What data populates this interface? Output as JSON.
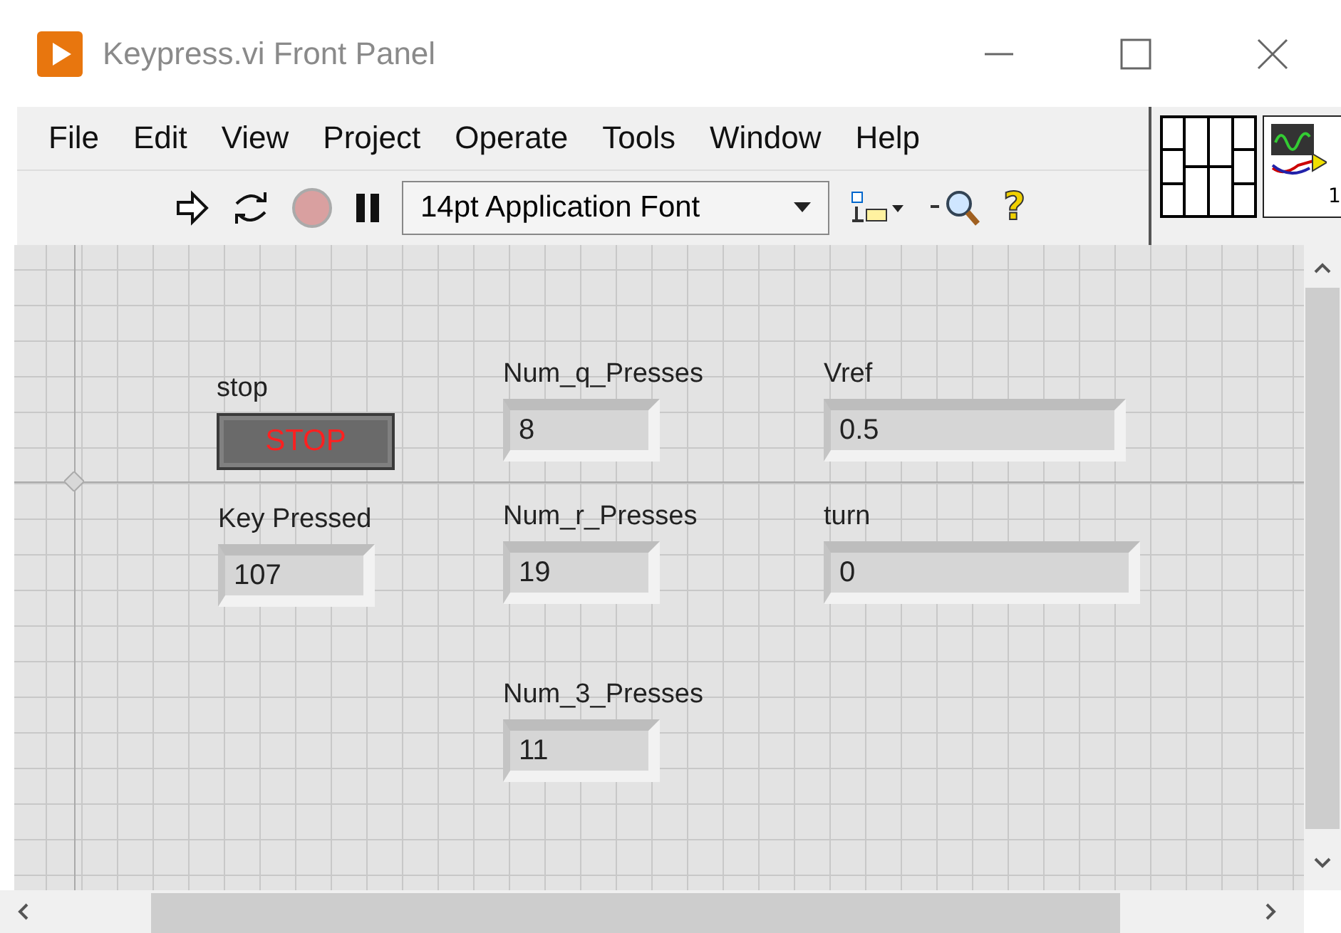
{
  "window": {
    "title": "Keypress.vi Front Panel"
  },
  "menu": [
    "File",
    "Edit",
    "View",
    "Project",
    "Operate",
    "Tools",
    "Window",
    "Help"
  ],
  "toolbar": {
    "font_selector": "14pt Application Font",
    "help_glyph": "?"
  },
  "vi_icon": {
    "label": "1"
  },
  "controls": [
    {
      "kind": "button",
      "label": "stop",
      "text": "STOP"
    },
    {
      "kind": "numeric",
      "label": "Key Pressed",
      "value": "107"
    },
    {
      "kind": "numeric",
      "label": "Num_q_Presses",
      "value": "8"
    },
    {
      "kind": "numeric",
      "label": "Num_r_Presses",
      "value": "19"
    },
    {
      "kind": "numeric",
      "label": "Num_3_Presses",
      "value": "11"
    },
    {
      "kind": "numeric",
      "label": "Vref",
      "value": "0.5"
    },
    {
      "kind": "numeric",
      "label": "turn",
      "value": "0"
    }
  ]
}
